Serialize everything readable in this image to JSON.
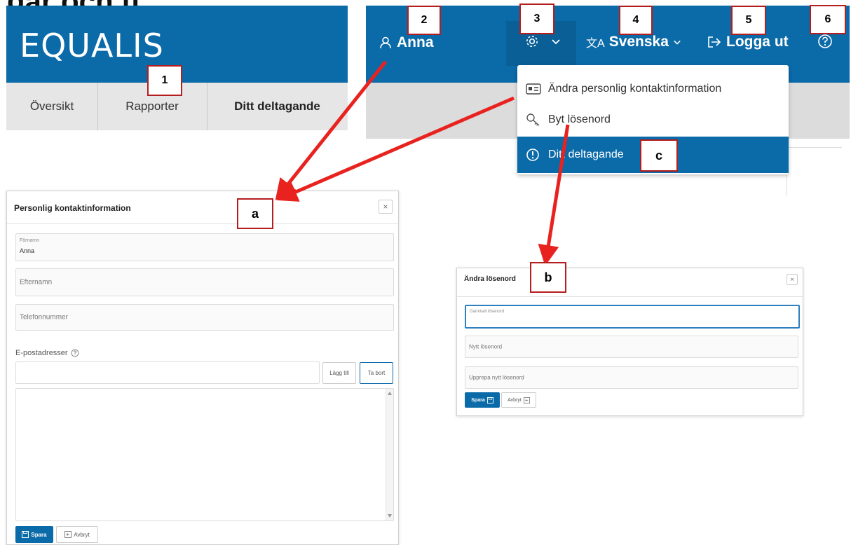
{
  "heading_fragment": "gar och tj",
  "left_crop": {
    "logo": "EQUALIS",
    "tabs": [
      "Översikt",
      "Rapporter",
      "Ditt deltagande"
    ]
  },
  "right_crop": {
    "user_name": "Anna",
    "language": "Svenska",
    "logout": "Logga ut",
    "menu": [
      {
        "label": "Ändra personlig kontaktinformation",
        "icon": "id-card-icon"
      },
      {
        "label": "Byt lösenord",
        "icon": "key-icon"
      },
      {
        "label": "Ditt deltagande",
        "icon": "info-circle-icon"
      }
    ]
  },
  "callouts": {
    "one": "1",
    "two": "2",
    "three": "3",
    "four": "4",
    "five": "5",
    "six": "6",
    "a": "a",
    "b": "b",
    "c": "c"
  },
  "contact_dialog": {
    "title": "Personlig kontaktinformation",
    "close": "×",
    "firstname_label": "Förnamn",
    "firstname_value": "Anna",
    "lastname_placeholder": "Efternamn",
    "phone_placeholder": "Telefonnummer",
    "email_label": "E-postadresser",
    "add_button": "Lägg till",
    "remove_button": "Ta bort",
    "save_button": "Spara",
    "cancel_button": "Avbryt"
  },
  "password_dialog": {
    "title": "Ändra lösenord",
    "close": "×",
    "old_password": "Gammalt lösenord",
    "new_password": "Nytt lösenord",
    "repeat_password": "Upprepa nytt lösenord",
    "save_button": "Spara",
    "cancel_button": "Avbryt"
  },
  "colors": {
    "brand_blue": "#0b6aa8",
    "arrow_red": "#e8231f",
    "callout_border": "#b51e1e"
  }
}
